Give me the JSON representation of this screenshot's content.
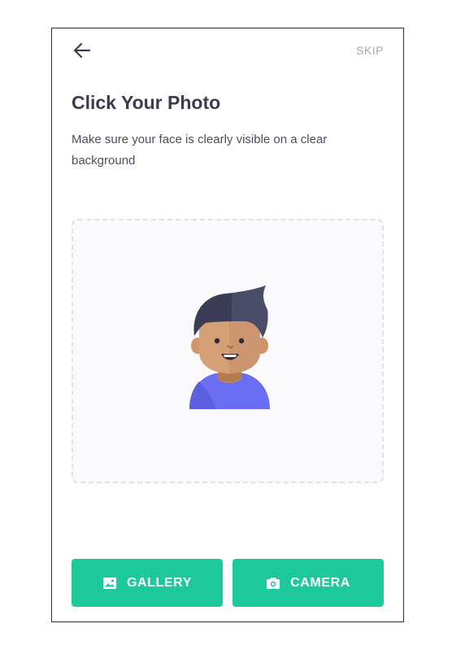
{
  "header": {
    "back_icon": "arrow-left-icon",
    "skip_label": "SKIP"
  },
  "content": {
    "title": "Click Your Photo",
    "subtitle": "Make sure your face is clearly visible on a clear background"
  },
  "placeholder": {
    "illustration": "avatar-illustration"
  },
  "actions": {
    "gallery_label": "GALLERY",
    "gallery_icon": "image-icon",
    "camera_label": "CAMERA",
    "camera_icon": "camera-icon"
  },
  "colors": {
    "accent": "#1dc99a",
    "title_text": "#3a3d4e",
    "muted_text": "#a7abb4"
  }
}
